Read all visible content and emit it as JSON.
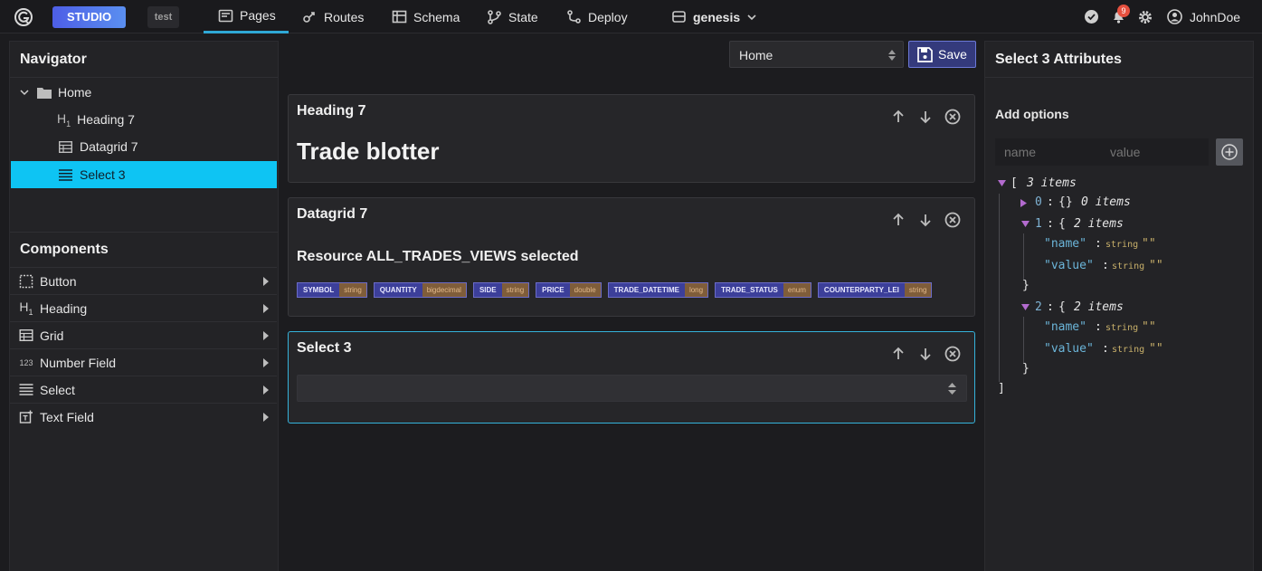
{
  "topbar": {
    "studio_label": "STUDIO",
    "env_label": "test",
    "tabs": [
      {
        "label": "Pages",
        "icon": "pages-icon",
        "active": true
      },
      {
        "label": "Routes",
        "icon": "routes-icon"
      },
      {
        "label": "Schema",
        "icon": "schema-icon"
      },
      {
        "label": "State",
        "icon": "state-icon"
      },
      {
        "label": "Deploy",
        "icon": "deploy-icon"
      }
    ],
    "project": "genesis",
    "notification_count": "9",
    "user": "JohnDoe"
  },
  "navigator": {
    "title": "Navigator",
    "tree": [
      {
        "label": "Home",
        "icon": "folder-icon"
      },
      {
        "label": "Heading 7",
        "icon": "heading-icon"
      },
      {
        "label": "Datagrid 7",
        "icon": "grid-icon"
      },
      {
        "label": "Select 3",
        "icon": "select-icon",
        "selected": true
      }
    ]
  },
  "components": {
    "title": "Components",
    "items": [
      {
        "label": "Button",
        "icon": "button-icon"
      },
      {
        "label": "Heading",
        "icon": "heading-icon"
      },
      {
        "label": "Grid",
        "icon": "grid-icon"
      },
      {
        "label": "Number Field",
        "icon": "number-field-icon",
        "glyph": "123"
      },
      {
        "label": "Select",
        "icon": "select-icon"
      },
      {
        "label": "Text Field",
        "icon": "text-field-icon"
      }
    ]
  },
  "toolbar": {
    "page_select_value": "Home",
    "save_label": "Save"
  },
  "canvas": {
    "heading_card": {
      "title": "Heading 7",
      "text": "Trade blotter"
    },
    "datagrid_card": {
      "title": "Datagrid 7",
      "resource_text": "Resource ALL_TRADES_VIEWS selected",
      "fields": [
        {
          "name": "SYMBOL",
          "type": "string"
        },
        {
          "name": "QUANTITY",
          "type": "bigdecimal"
        },
        {
          "name": "SIDE",
          "type": "string"
        },
        {
          "name": "PRICE",
          "type": "double"
        },
        {
          "name": "TRADE_DATETIME",
          "type": "long"
        },
        {
          "name": "TRADE_STATUS",
          "type": "enum"
        },
        {
          "name": "COUNTERPARTY_LEI",
          "type": "string"
        }
      ]
    },
    "select_card": {
      "title": "Select 3",
      "value": ""
    }
  },
  "attributes": {
    "title": "Select 3 Attributes",
    "add_options_label": "Add options",
    "name_placeholder": "name",
    "value_placeholder": "value",
    "json_view": {
      "root_open": "[",
      "root_count": "3 items",
      "root_close": "]",
      "items": [
        {
          "index": "0",
          "open": "{}",
          "count": "0 items",
          "collapsed": true
        },
        {
          "index": "1",
          "open": "{",
          "count": "2 items",
          "close": "}",
          "entries": [
            {
              "key": "\"name\"",
              "type": "string",
              "value": "\"\""
            },
            {
              "key": "\"value\"",
              "type": "string",
              "value": "\"\""
            }
          ]
        },
        {
          "index": "2",
          "open": "{",
          "count": "2 items",
          "close": "}",
          "entries": [
            {
              "key": "\"name\"",
              "type": "string",
              "value": "\"\""
            },
            {
              "key": "\"value\"",
              "type": "string",
              "value": "\"\""
            }
          ]
        }
      ]
    }
  },
  "colors": {
    "accent": "#0ec4f3",
    "studio_gradient": "#4d5ee6",
    "badge": "#e5503f"
  }
}
